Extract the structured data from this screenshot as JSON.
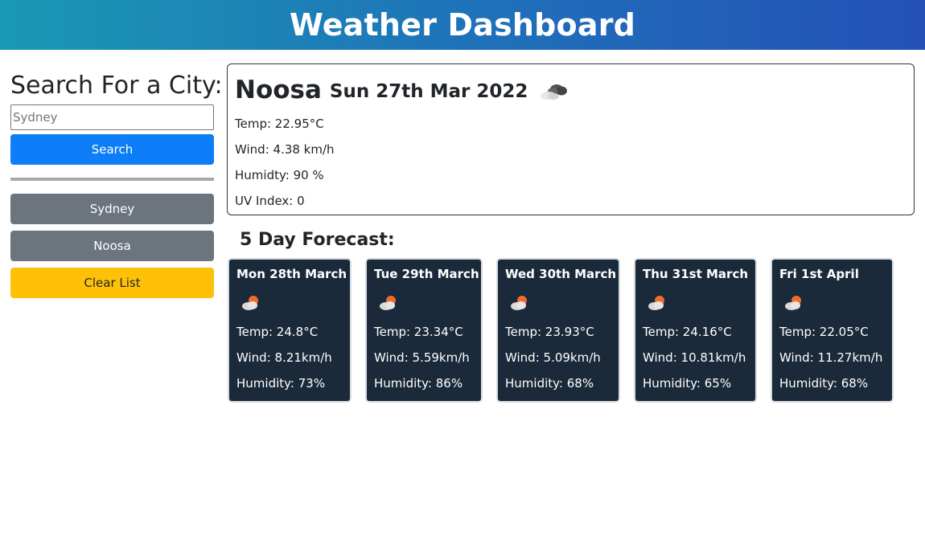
{
  "header": {
    "title": "Weather Dashboard"
  },
  "sidebar": {
    "heading": "Search For a City:",
    "search_value": "",
    "search_placeholder": "Sydney",
    "search_button": "Search",
    "history": [
      {
        "label": "Sydney"
      },
      {
        "label": "Noosa"
      }
    ],
    "clear_button": "Clear List"
  },
  "current": {
    "city": "Noosa",
    "date": "Sun 27th Mar 2022",
    "icon": "broken-clouds-icon",
    "temp": "Temp: 22.95°C",
    "wind": "Wind: 4.38 km/h",
    "humidity": "Humidty: 90 %",
    "uv": "UV Index: 0"
  },
  "forecast": {
    "title": "5 Day Forecast:",
    "days": [
      {
        "date": "Mon 28th March",
        "icon": "partly-cloudy-sun-icon",
        "temp": "Temp: 24.8°C",
        "wind": "Wind: 8.21km/h",
        "humidity": "Humidity: 73%"
      },
      {
        "date": "Tue 29th March",
        "icon": "partly-cloudy-sun-icon",
        "temp": "Temp: 23.34°C",
        "wind": "Wind: 5.59km/h",
        "humidity": "Humidity: 86%"
      },
      {
        "date": "Wed 30th March",
        "icon": "partly-cloudy-sun-icon",
        "temp": "Temp: 23.93°C",
        "wind": "Wind: 5.09km/h",
        "humidity": "Humidity: 68%"
      },
      {
        "date": "Thu 31st March",
        "icon": "partly-cloudy-sun-icon",
        "temp": "Temp: 24.16°C",
        "wind": "Wind: 10.81km/h",
        "humidity": "Humidity: 65%"
      },
      {
        "date": "Fri 1st April",
        "icon": "partly-cloudy-sun-icon",
        "temp": "Temp: 22.05°C",
        "wind": "Wind: 11.27km/h",
        "humidity": "Humidity: 68%"
      }
    ]
  },
  "colors": {
    "header_gradient_start": "#1a98b4",
    "header_gradient_end": "#2450b8",
    "search_button": "#0d7ef8",
    "history_button": "#6c757d",
    "clear_button": "#ffc107",
    "forecast_card": "#1a2a3a"
  }
}
